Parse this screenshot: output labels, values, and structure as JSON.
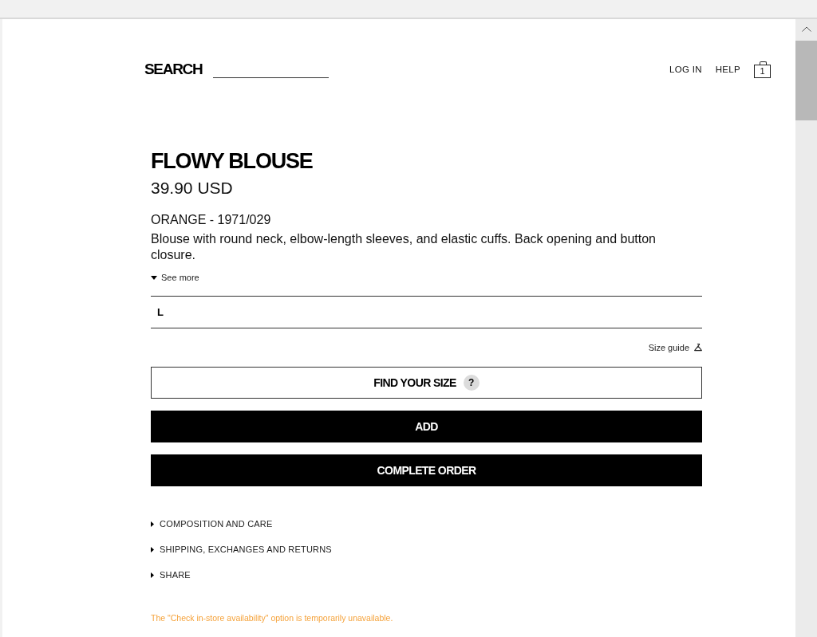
{
  "header": {
    "search": {
      "label": "SEARCH"
    },
    "links": [
      "LOG IN",
      "HELP"
    ],
    "cart": {
      "count": "1"
    }
  },
  "product": {
    "name": "FLOWY BLOUSE",
    "price": "39.90 USD",
    "color_ref": "ORANGE - 1971/029",
    "description": "Blouse with round neck, elbow-length sleeves, and elastic cuffs. Back opening and button closure.",
    "see_more": "See more"
  },
  "size_select": {
    "value": "L"
  },
  "size_guide": "Size guide",
  "buttons": [
    {
      "label": "FIND YOUR SIZE",
      "kind": "outline",
      "help_mark": "?"
    },
    {
      "label": "ADD",
      "kind": "primary"
    },
    {
      "label": "COMPLETE ORDER",
      "kind": "primary"
    }
  ],
  "sections": [
    {
      "label": "COMPOSITION AND CARE",
      "expanded": false
    },
    {
      "label": "SHIPPING, EXCHANGES AND RETURNS",
      "expanded": false
    },
    {
      "label": "SHARE",
      "expanded": false
    }
  ],
  "notice": "The \"Check in-store availability\" option is temporarily unavailable."
}
